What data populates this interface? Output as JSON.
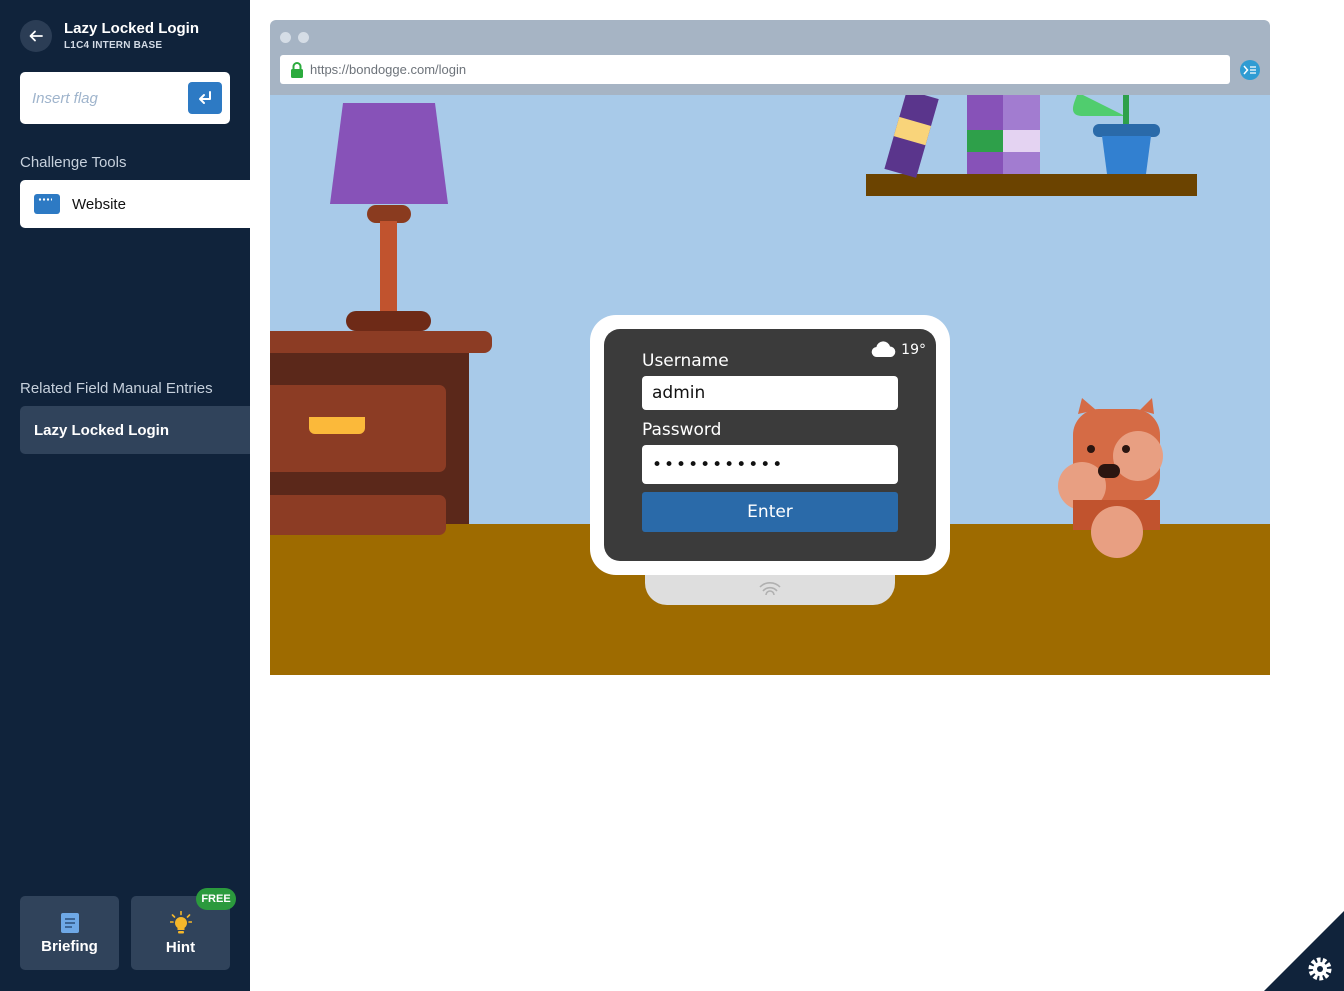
{
  "sidebar": {
    "title": "Lazy Locked Login",
    "subtitle": "L1C4 INTERN BASE",
    "flag_placeholder": "Insert flag",
    "tools_heading": "Challenge Tools",
    "tools": [
      {
        "label": "Website",
        "icon": "browser-window-icon"
      }
    ],
    "manual_heading": "Related Field Manual Entries",
    "manual_entries": [
      {
        "label": "Lazy Locked Login"
      }
    ],
    "briefing_label": "Briefing",
    "hint_label": "Hint",
    "hint_badge": "FREE"
  },
  "browser": {
    "url": "https://bondogge.com/login"
  },
  "login": {
    "weather_temp": "19°",
    "username_label": "Username",
    "username_value": "admin",
    "password_label": "Password",
    "password_value": "•••••••••••",
    "enter_label": "Enter"
  },
  "colors": {
    "sidebar_bg": "#10233b",
    "accent_blue": "#2d7ac4",
    "wall": "#a8cae9",
    "floor": "#9e6b00",
    "free_badge": "#2b9a3d"
  }
}
